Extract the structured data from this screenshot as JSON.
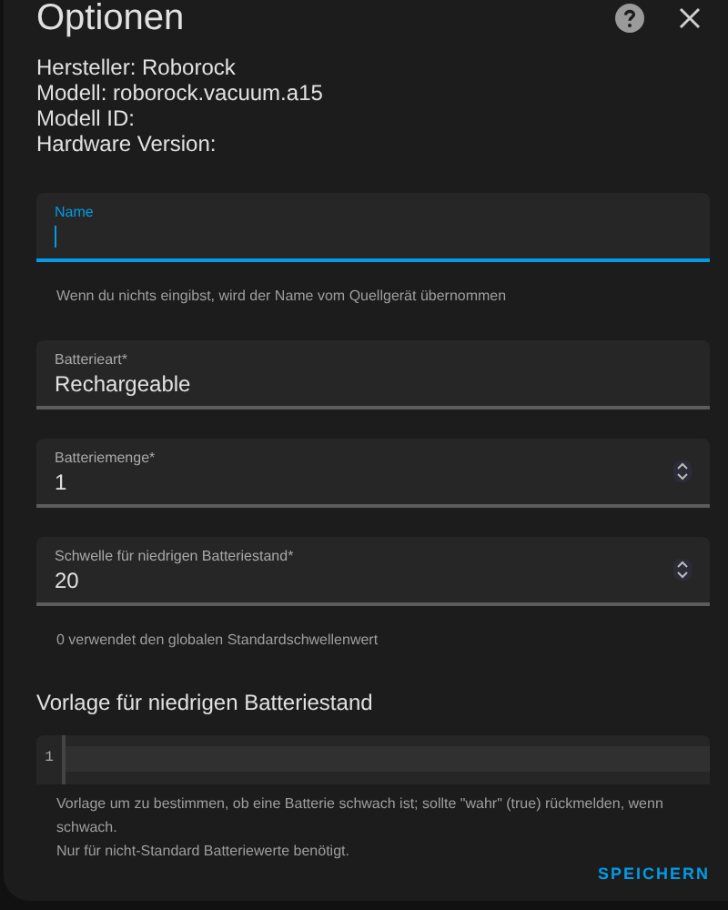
{
  "dialog": {
    "title": "Optionen"
  },
  "info": [
    "Hersteller: Roborock",
    "Modell: roborock.vacuum.a15",
    "Modell ID:",
    "Hardware Version:"
  ],
  "fields": [
    {
      "kind": "text",
      "label": "Name",
      "focused": true,
      "helper": "Wenn du nichts eingibst, wird der Name vom Quellgerät übernommen"
    },
    {
      "kind": "text",
      "label": "Batterieart*",
      "value": "Rechargeable",
      "focused": false
    },
    {
      "kind": "number",
      "label": "Batteriemenge*",
      "value": "1",
      "focused": false
    },
    {
      "kind": "number",
      "label": "Schwelle für niedrigen Batteriestand*",
      "value": "20",
      "focused": false,
      "helper": "0 verwendet den globalen Standardschwellenwert"
    }
  ],
  "template": {
    "heading": "Vorlage für niedrigen Batteriestand",
    "line_number": "1",
    "helper_lines": [
      "Vorlage um zu bestimmen, ob eine Batterie schwach ist; sollte \"wahr\" (true) rückmelden, wenn schwach.",
      "Nur für nicht-Standard Batteriewerte benötigt."
    ]
  },
  "save_button": "SPEICHERN"
}
